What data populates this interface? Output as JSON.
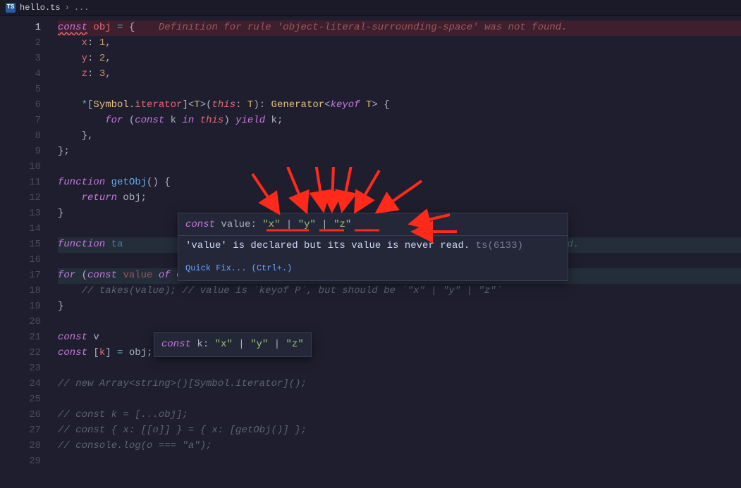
{
  "tab": {
    "icon": "TS",
    "filename": "hello.ts",
    "bcsep": "›",
    "bcell": "..."
  },
  "gutter": {
    "start": 1,
    "end": 29
  },
  "code": {
    "l1": {
      "kw": "const",
      "id": "obj",
      "op": "=",
      "br": "{",
      "lint": "Definition for rule 'object-literal-surrounding-space' was not found."
    },
    "l2": {
      "id": "x",
      "c": ":",
      "n": "1",
      "cm": ","
    },
    "l3": {
      "id": "y",
      "c": ":",
      "n": "2",
      "cm": ","
    },
    "l4": {
      "id": "z",
      "c": ":",
      "n": "3",
      "cm": ","
    },
    "l6": {
      "star": "*",
      "bo": "[",
      "sym": "Symbol",
      "dot": ".",
      "it": "iterator",
      "bc": "]",
      "lt": "<",
      "T": "T",
      "gt": ">",
      "po": "(",
      "this": "this",
      "col": ": ",
      "T2": "T",
      "pc": ")",
      "col2": ": ",
      "gen": "Generator",
      "lt2": "<",
      "ko": "keyof ",
      "T3": "T",
      "gt2": ">",
      "ob": " {"
    },
    "l7": {
      "for": "for",
      "po": " (",
      "const": "const",
      "k": " k ",
      "in": "in",
      "sp": " ",
      "this": "this",
      "pc": ") ",
      "yield": "yield",
      "k2": " k",
      "sc": ";"
    },
    "l8": {
      "cb": "},"
    },
    "l9": {
      "t": "};"
    },
    "l11": {
      "fn": "function",
      "name": " getObj",
      "sig": "() {",
      "po": "(",
      "pc": ")",
      "ob": " {"
    },
    "l12": {
      "ret": "return",
      "obj": " obj",
      "sc": ";"
    },
    "l13": {
      "t": "}"
    },
    "l15": {
      "fn": "function",
      "name": " ta",
      "lint": "is never read."
    },
    "l17": {
      "for": "for",
      "po": " (",
      "const": "const",
      "val": " value ",
      "of": "of",
      "obj": " obj",
      "pc": ") {",
      "lint": "'value' is declared but its value is never read."
    },
    "l18": {
      "cm": "// takes(value); // value is `keyof P`, but should be `\"x\" | \"y\" | \"z\"`"
    },
    "l19": {
      "t": "}"
    },
    "l21": {
      "const": "const",
      "v": " v"
    },
    "l22": {
      "const": "const",
      "br": " [",
      "k": "k",
      "brc": "] ",
      "eq": "=",
      "obj": " obj",
      "sc": ";"
    },
    "l24": {
      "t": "// new Array<string>()[Symbol.iterator]();"
    },
    "l26": {
      "t": "// const k = [...obj];"
    },
    "l27": {
      "t": "// const { x: [[o]] } = { x: [getObj()] };"
    },
    "l28": {
      "t": "// console.log(o === \"a\");"
    }
  },
  "hover1": {
    "sig": {
      "const": "const",
      "name": " value",
      "col": ": ",
      "x": "\"x\"",
      "p1": " | ",
      "y": "\"y\"",
      "p2": " | ",
      "z": "\"z\""
    },
    "msg": "'value' is declared but its value is never read.",
    "tscode": " ts(6133)",
    "qf": "Quick Fix... (Ctrl+.)"
  },
  "hover2": {
    "const": "const",
    "name": " k",
    "col": ": ",
    "x": "\"x\"",
    "p1": " | ",
    "y": "\"y\"",
    "p2": " | ",
    "z": "\"z\""
  }
}
